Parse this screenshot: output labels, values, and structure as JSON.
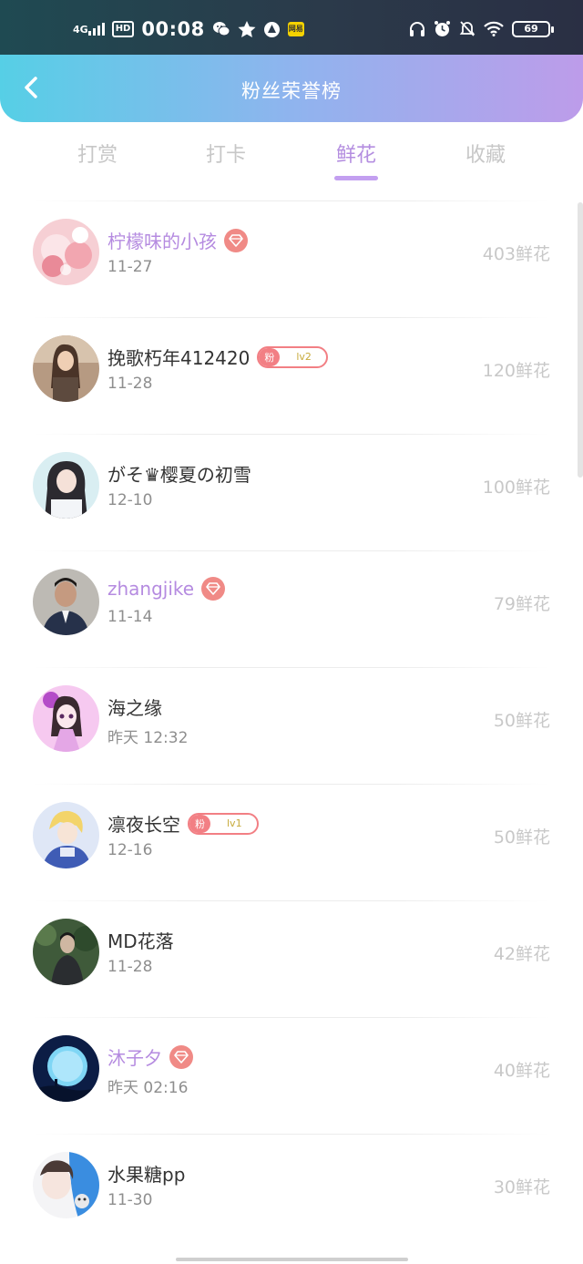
{
  "status_bar": {
    "time": "00:08",
    "network": "4G",
    "hd": "HD",
    "app_badge": "网易",
    "battery": "69"
  },
  "header": {
    "title": "粉丝荣誉榜"
  },
  "tabs": [
    {
      "label": "打赏",
      "active": false
    },
    {
      "label": "打卡",
      "active": false
    },
    {
      "label": "鲜花",
      "active": true
    },
    {
      "label": "收藏",
      "active": false
    }
  ],
  "badge_texts": {
    "fan": "粉"
  },
  "rows": [
    {
      "name": "柠檬味的小孩",
      "date": "11-27",
      "amount": "403鲜花",
      "vip": true
    },
    {
      "name": "挽歌朽年412420",
      "date": "11-28",
      "amount": "120鲜花",
      "fan_level": "lv2"
    },
    {
      "name": "がそ♛樱夏の初雪",
      "date": "12-10",
      "amount": "100鲜花"
    },
    {
      "name": "zhangjike",
      "date": "11-14",
      "amount": "79鲜花",
      "vip": true
    },
    {
      "name": "海之缘",
      "date": "昨天 12:32",
      "amount": "50鲜花"
    },
    {
      "name": "凛夜长空",
      "date": "12-16",
      "amount": "50鲜花",
      "fan_level": "lv1"
    },
    {
      "name": "MD花落",
      "date": "11-28",
      "amount": "42鲜花"
    },
    {
      "name": "沐子夕",
      "date": "昨天 02:16",
      "amount": "40鲜花",
      "vip": true
    },
    {
      "name": "水果糖pp",
      "date": "11-30",
      "amount": "30鲜花"
    }
  ],
  "colors": {
    "accent": "#b48ee0",
    "vip_name": "#b58be0",
    "badge": "#f27f84",
    "muted": "#c8c8c8"
  }
}
